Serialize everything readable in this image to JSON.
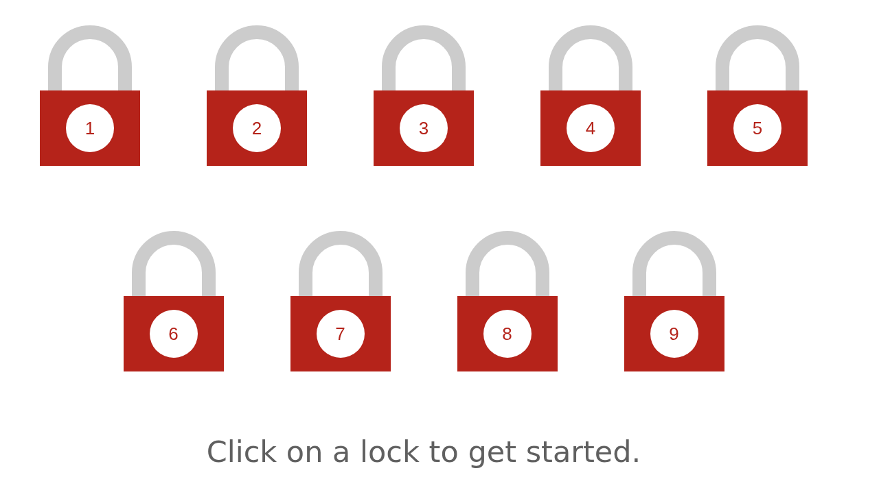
{
  "locks": [
    {
      "number": "1"
    },
    {
      "number": "2"
    },
    {
      "number": "3"
    },
    {
      "number": "4"
    },
    {
      "number": "5"
    },
    {
      "number": "6"
    },
    {
      "number": "7"
    },
    {
      "number": "8"
    },
    {
      "number": "9"
    }
  ],
  "hint": "Click on a lock to get started."
}
